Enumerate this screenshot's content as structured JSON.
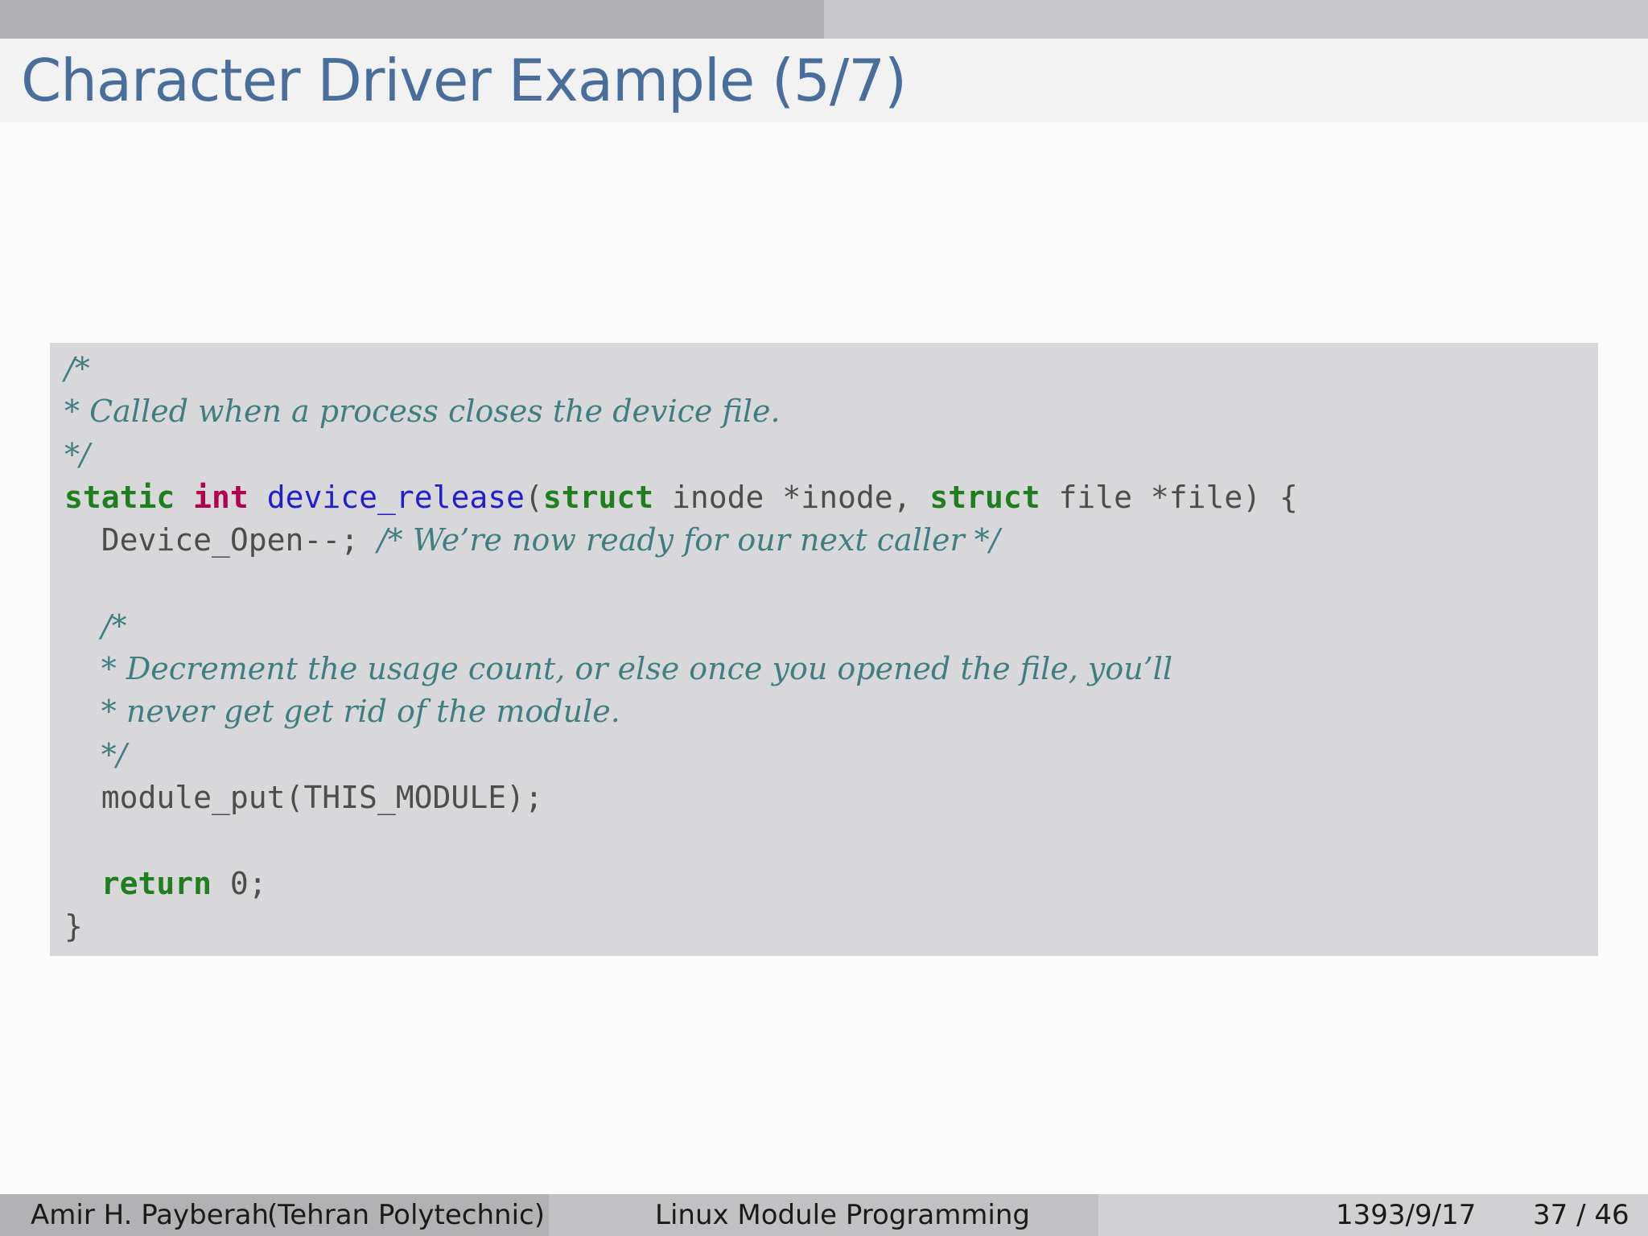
{
  "slide": {
    "title": "Character Driver Example (5/7)"
  },
  "code": {
    "lines": [
      [
        {
          "t": "/*",
          "c": "cm"
        }
      ],
      [
        {
          "t": "* Called when a process closes the device file.",
          "c": "cm"
        }
      ],
      [
        {
          "t": "*/",
          "c": "cm"
        }
      ],
      [
        {
          "t": "static",
          "c": "kw"
        },
        {
          "t": " ",
          "c": ""
        },
        {
          "t": "int",
          "c": "ty"
        },
        {
          "t": " ",
          "c": ""
        },
        {
          "t": "device_release",
          "c": "fn"
        },
        {
          "t": "(",
          "c": ""
        },
        {
          "t": "struct",
          "c": "kw"
        },
        {
          "t": " inode *inode, ",
          "c": ""
        },
        {
          "t": "struct",
          "c": "kw"
        },
        {
          "t": " file *file) {",
          "c": ""
        }
      ],
      [
        {
          "t": "  Device_Open--; ",
          "c": ""
        },
        {
          "t": "/* We’re now ready for our next caller */",
          "c": "cm"
        }
      ],
      [
        {
          "t": "",
          "c": ""
        }
      ],
      [
        {
          "t": "  ",
          "c": ""
        },
        {
          "t": "/*",
          "c": "cm"
        }
      ],
      [
        {
          "t": "  ",
          "c": ""
        },
        {
          "t": "* Decrement the usage count, or else once you opened the file, you’ll",
          "c": "cm"
        }
      ],
      [
        {
          "t": "  ",
          "c": ""
        },
        {
          "t": "* never get get rid of the module.",
          "c": "cm"
        }
      ],
      [
        {
          "t": "  ",
          "c": ""
        },
        {
          "t": "*/",
          "c": "cm"
        }
      ],
      [
        {
          "t": "  module_put(THIS_MODULE);",
          "c": ""
        }
      ],
      [
        {
          "t": "",
          "c": ""
        }
      ],
      [
        {
          "t": "  ",
          "c": ""
        },
        {
          "t": "return",
          "c": "kw"
        },
        {
          "t": " 0;",
          "c": ""
        }
      ],
      [
        {
          "t": "}",
          "c": ""
        }
      ]
    ]
  },
  "footer": {
    "author": "Amir H. Payberah",
    "institution": "(Tehran Polytechnic)",
    "course": "Linux Module Programming",
    "date": "1393/9/17",
    "page": "37 / 46"
  },
  "colors": {
    "title": "#4a6e9c",
    "comment": "#3f7f7f",
    "keyword": "#1f7f1f",
    "type": "#b0004f",
    "function": "#1f1fcf",
    "code_background": "#d8d8db"
  }
}
